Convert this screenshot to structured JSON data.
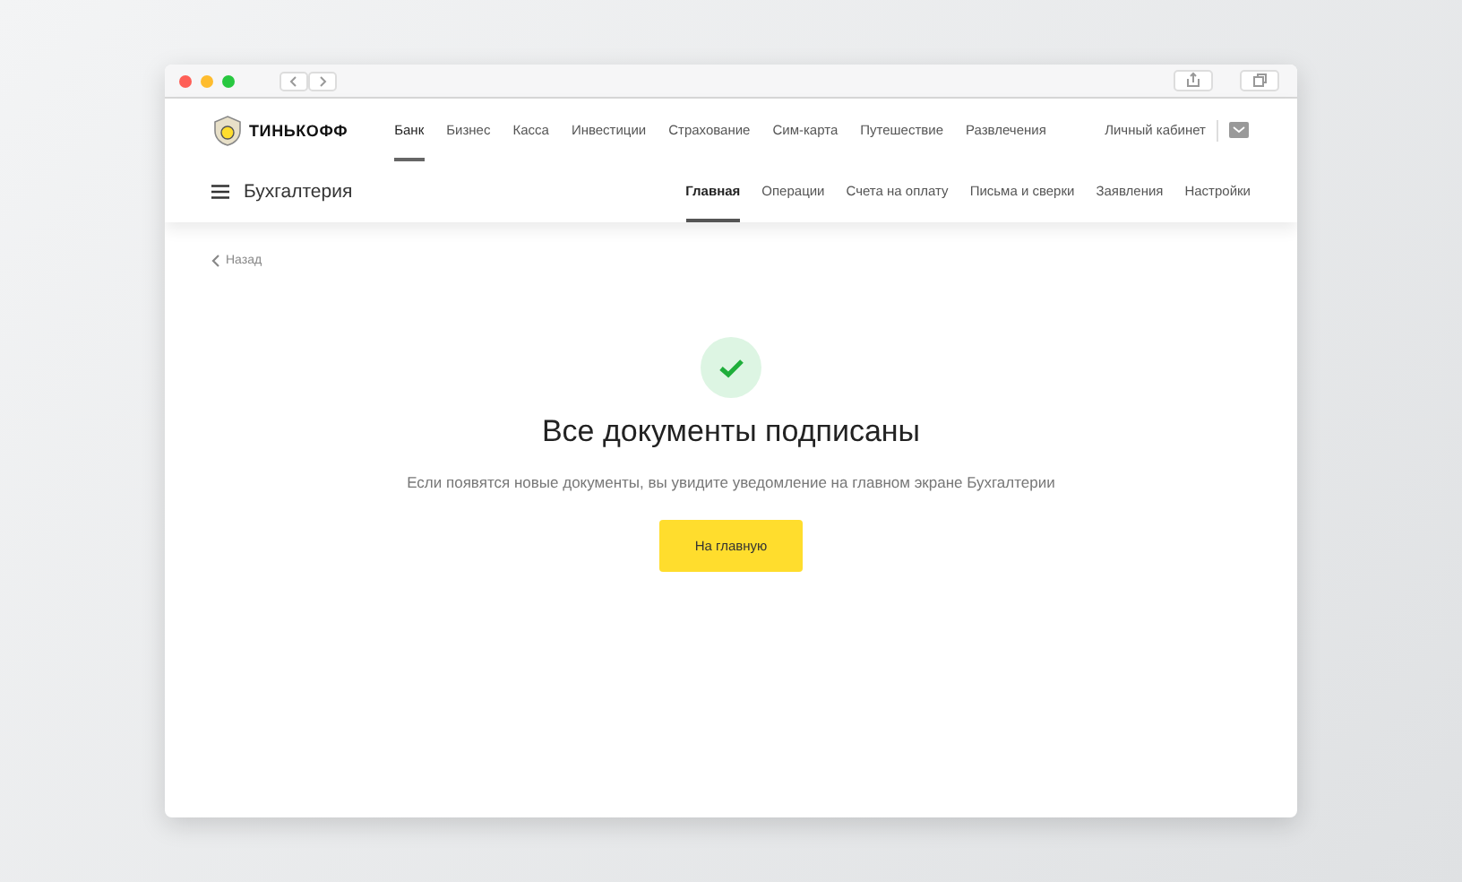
{
  "brand": {
    "name": "ТИНЬКОФФ"
  },
  "top_nav": [
    {
      "label": "Банк",
      "selected": true
    },
    {
      "label": "Бизнес",
      "selected": false
    },
    {
      "label": "Касса",
      "selected": false
    },
    {
      "label": "Инвестиции",
      "selected": false
    },
    {
      "label": "Страхование",
      "selected": false
    },
    {
      "label": "Сим-карта",
      "selected": false
    },
    {
      "label": "Путешествие",
      "selected": false
    },
    {
      "label": "Развлечения",
      "selected": false
    }
  ],
  "account_link": "Личный кабинет",
  "section": {
    "title": "Бухгалтерия"
  },
  "tabs": [
    {
      "label": "Главная",
      "selected": true
    },
    {
      "label": "Операции",
      "selected": false
    },
    {
      "label": "Счета на оплату",
      "selected": false
    },
    {
      "label": "Письма и сверки",
      "selected": false
    },
    {
      "label": "Заявления",
      "selected": false
    },
    {
      "label": "Настройки",
      "selected": false
    }
  ],
  "back_link": "Назад",
  "result": {
    "title": "Все документы подписаны",
    "message": "Если появятся новые документы, вы увидите уведомление на главном экране Бухгалтерии",
    "button": "На главную"
  }
}
